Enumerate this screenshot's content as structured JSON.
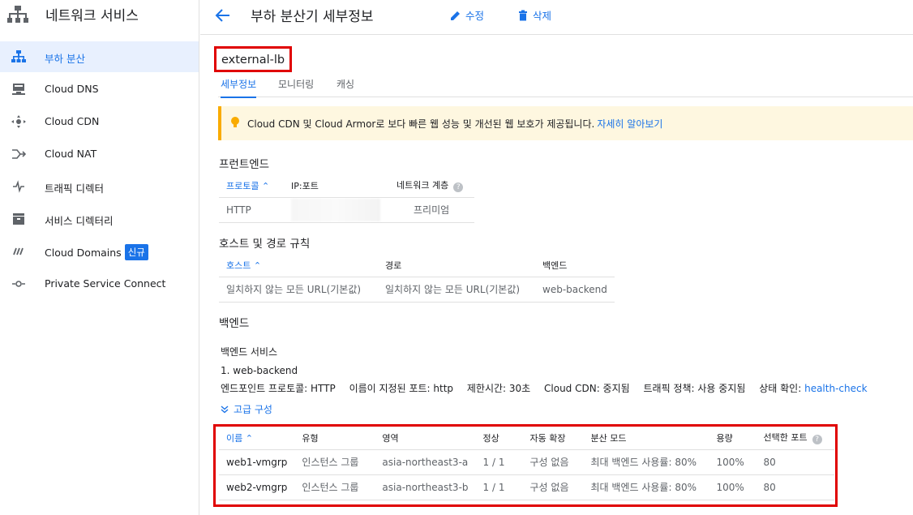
{
  "sidebar": {
    "title": "네트워크 서비스",
    "items": [
      {
        "label": "부하 분산",
        "icon": "load-balancing-icon",
        "active": true
      },
      {
        "label": "Cloud DNS",
        "icon": "dns-icon"
      },
      {
        "label": "Cloud CDN",
        "icon": "cdn-icon"
      },
      {
        "label": "Cloud NAT",
        "icon": "nat-icon"
      },
      {
        "label": "트래픽 디렉터",
        "icon": "traffic-director-icon"
      },
      {
        "label": "서비스 디렉터리",
        "icon": "service-directory-icon"
      },
      {
        "label": "Cloud Domains",
        "icon": "domains-icon",
        "badge": "신규"
      },
      {
        "label": "Private Service Connect",
        "icon": "private-service-connect-icon"
      }
    ]
  },
  "topbar": {
    "title": "부하 분산기 세부정보",
    "edit_label": "수정",
    "delete_label": "삭제"
  },
  "lb_name": "external-lb",
  "tabs": [
    "세부정보",
    "모니터링",
    "캐싱"
  ],
  "banner": {
    "text": "Cloud CDN 및 Cloud Armor로 보다 빠른 웹 성능 및 개선된 웹 보호가 제공됩니다.",
    "link": "자세히 알아보기"
  },
  "frontend": {
    "title": "프런트엔드",
    "headers": [
      "프로토콜",
      "IP:포트",
      "네트워크 계층"
    ],
    "row": {
      "protocol": "HTTP",
      "tier": "프리미엄"
    }
  },
  "host_rules": {
    "title": "호스트 및 경로 규칙",
    "headers": [
      "호스트",
      "경로",
      "백엔드"
    ],
    "row": [
      "일치하지 않는 모든 URL(기본값)",
      "일치하지 않는 모든 URL(기본값)",
      "web-backend"
    ]
  },
  "backend": {
    "title": "백엔드",
    "service_title": "백엔드 서비스",
    "service_name": "1. web-backend",
    "props": {
      "endpoint_protocol": "엔드포인트 프로토콜: HTTP",
      "named_port": "이름이 지정된 포트: http",
      "timeout": "제한시간: 30초",
      "cdn": "Cloud CDN: 중지됨",
      "traffic_policy": "트래픽 정책: 사용 중지됨",
      "health_label": "상태 확인:",
      "health_link": "health-check"
    },
    "advanced_label": "고급 구성",
    "table": {
      "headers": [
        "이름",
        "유형",
        "영역",
        "정상",
        "자동 확장",
        "분산 모드",
        "용량",
        "선택한 포트"
      ],
      "rows": [
        [
          "web1-vmgrp",
          "인스턴스 그룹",
          "asia-northeast3-a",
          "1 / 1",
          "구성 없음",
          "최대 백엔드 사용률: 80%",
          "100%",
          "80"
        ],
        [
          "web2-vmgrp",
          "인스턴스 그룹",
          "asia-northeast3-b",
          "1 / 1",
          "구성 없음",
          "최대 백엔드 사용률: 80%",
          "100%",
          "80"
        ]
      ]
    }
  },
  "colors": {
    "accent": "#1a73e8",
    "highlight": "#e00000",
    "warning": "#f9ab00"
  }
}
